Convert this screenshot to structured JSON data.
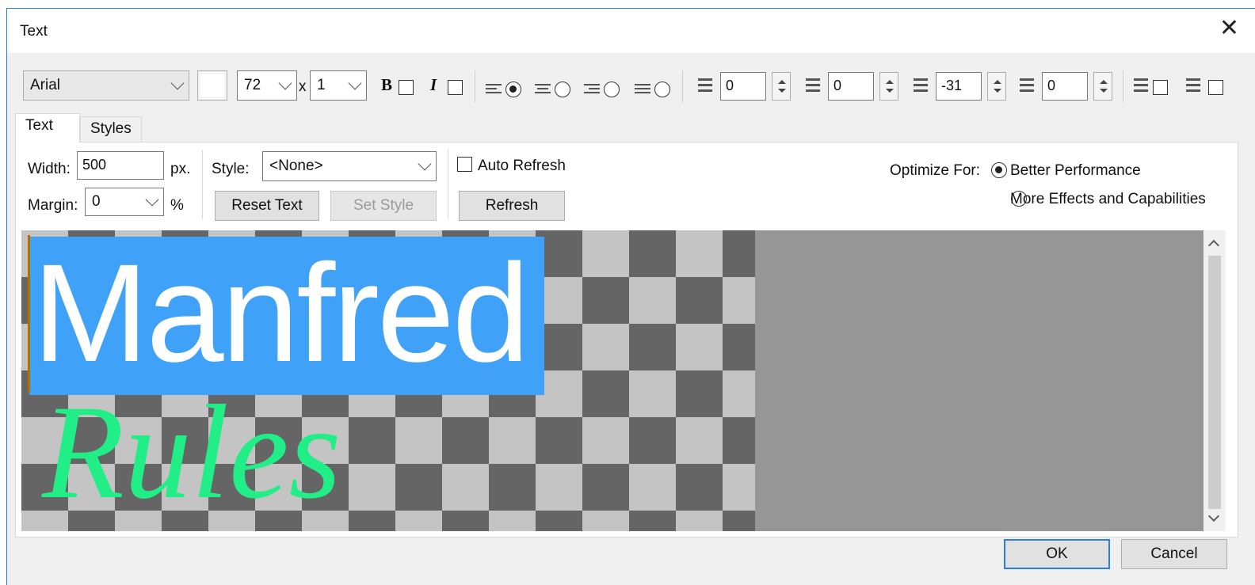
{
  "window": {
    "title": "Text",
    "close_glyph": "✕"
  },
  "toolbar": {
    "font": "Arial",
    "size": "72",
    "scale_prefix": "x",
    "scale": "1",
    "bold_glyph": "B",
    "italic_glyph": "I",
    "alignments": [
      "left",
      "center",
      "right",
      "justify"
    ],
    "alignment_selected": "left",
    "space_before": "0",
    "indent": "0",
    "line_spacing": "-31",
    "space_after": "0"
  },
  "tabs": [
    {
      "label": "Text",
      "active": true
    },
    {
      "label": "Styles",
      "active": false
    }
  ],
  "text_tab": {
    "width_label": "Width:",
    "width_value": "500",
    "width_unit": "px.",
    "margin_label": "Margin:",
    "margin_value": "0",
    "margin_unit": "%",
    "style_label": "Style:",
    "style_value": "<None>",
    "reset_text_label": "Reset Text",
    "set_style_label": "Set Style",
    "auto_refresh_label": "Auto Refresh",
    "refresh_label": "Refresh",
    "optimize_label": "Optimize For:",
    "optimize_options": [
      "Better Performance",
      "More Effects and Capabilities"
    ],
    "optimize_selected": "Better Performance"
  },
  "preview": {
    "line1": "Manfred",
    "line2": "Rules",
    "line1_color": "#ffffff",
    "line2_color": "#22ee88",
    "selection_color": "#3fa1f8"
  },
  "buttons": {
    "ok": "OK",
    "cancel": "Cancel"
  },
  "colors": {
    "accent": "#2b7fd4",
    "checker_dark": "#656565",
    "checker_light": "#c4c4c4"
  }
}
